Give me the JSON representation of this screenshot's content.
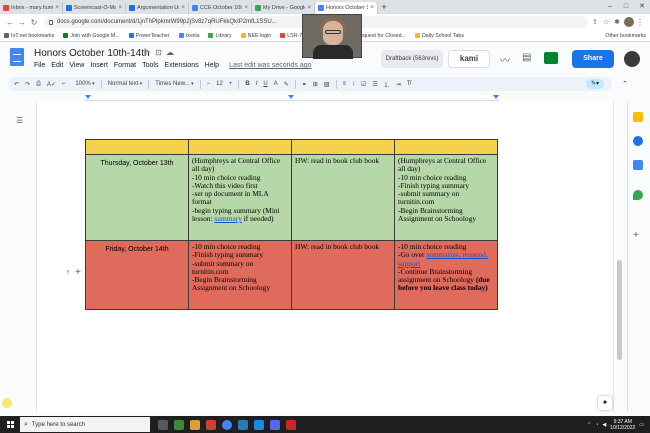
{
  "browser": {
    "tabs": [
      {
        "title": "Inbox - mary.humphreys@...",
        "color": "#ea4335"
      },
      {
        "title": "Screencast-O-Matic",
        "color": "#1a73e8"
      },
      {
        "title": "Argumentation Unit | Sch...",
        "color": "#1a73e8"
      },
      {
        "title": "CCE October 10th-14th",
        "color": "#4285f4"
      },
      {
        "title": "My Drive - Google Drive",
        "color": "#34a853"
      },
      {
        "title": "Honors October 10th-14th",
        "color": "#4285f4",
        "active": true
      }
    ],
    "url": "docs.google.com/document/d/1jnThPlpkmrW99p2jSv8z7qRUFkkQkIP2mfL1SSU...",
    "bookmarks": [
      {
        "label": "IoT.net bookmarks",
        "color": "#5f6368"
      },
      {
        "label": "Join with Google M...",
        "color": "#00832d"
      },
      {
        "label": "PowerTeacher",
        "color": "#1a73e8"
      },
      {
        "label": "Ixvela",
        "color": "#4285f4"
      },
      {
        "label": "Library",
        "color": "#34a853"
      },
      {
        "label": "NEE login",
        "color": "#fbbc04"
      },
      {
        "label": "LSR-7 Online Resou...",
        "color": "#ea4335"
      },
      {
        "label": "Request for Closed...",
        "color": "#1a73e8"
      },
      {
        "label": "Daily School Tabs",
        "color": "#fbbc04"
      }
    ],
    "other_bookmarks": "Other bookmarks"
  },
  "docs": {
    "title": "Honors October 10th-14th",
    "menu": [
      "File",
      "Edit",
      "View",
      "Insert",
      "Format",
      "Tools",
      "Extensions",
      "Help"
    ],
    "last_edit": "Last edit was seconds ago",
    "draftback": "Draftback (563revs)",
    "kami": "kami",
    "share": "Share"
  },
  "toolbar": {
    "zoom": "100%",
    "style": "Normal text",
    "font": "Times New...",
    "size": "12"
  },
  "table": {
    "thursday": {
      "day": "Thursday, October 13th",
      "col2_lines": [
        "(Humphreys at Central Office all day)",
        "-10 min choice reading",
        "-Watch this video first",
        "-set up document in MLA format",
        "-begin typing summary (Mini lesson: "
      ],
      "col2_link": "summary",
      "col2_tail": " if needed)",
      "col3": "HW: read in book club book",
      "col4_lines": [
        "(Humphreys at Central Office all day)",
        "-10 min choice reading",
        "-Finish typing summary",
        "-submit summary on turnitin.com",
        "-Begin Brainstorming Assignment on Schoology"
      ]
    },
    "friday": {
      "day": "Friday, October 14th",
      "col2_lines": [
        "-10 min choice reading",
        "-Finish typing summary",
        "-submit summary on turnitin.com",
        "-Begin Brainstorming Assignment on Schoology"
      ],
      "col3": "HW: read in book club book",
      "col4_line1": "-10 min choice reading",
      "col4_go": "-Go over ",
      "col4_link": "summarize, respond, support",
      "col4_continue": "-Continue Brainstorming assignment on Schoology ",
      "col4_bold": "(due before you leave class today)"
    }
  },
  "taskbar": {
    "search_placeholder": "Type here to search",
    "time": "9:37 AM",
    "date": "10/12/2022"
  },
  "colors": {
    "header_row": "#f5d24d",
    "thursday_row": "#b6d7a8",
    "friday_row": "#e06b5d",
    "accent": "#1a73e8"
  }
}
